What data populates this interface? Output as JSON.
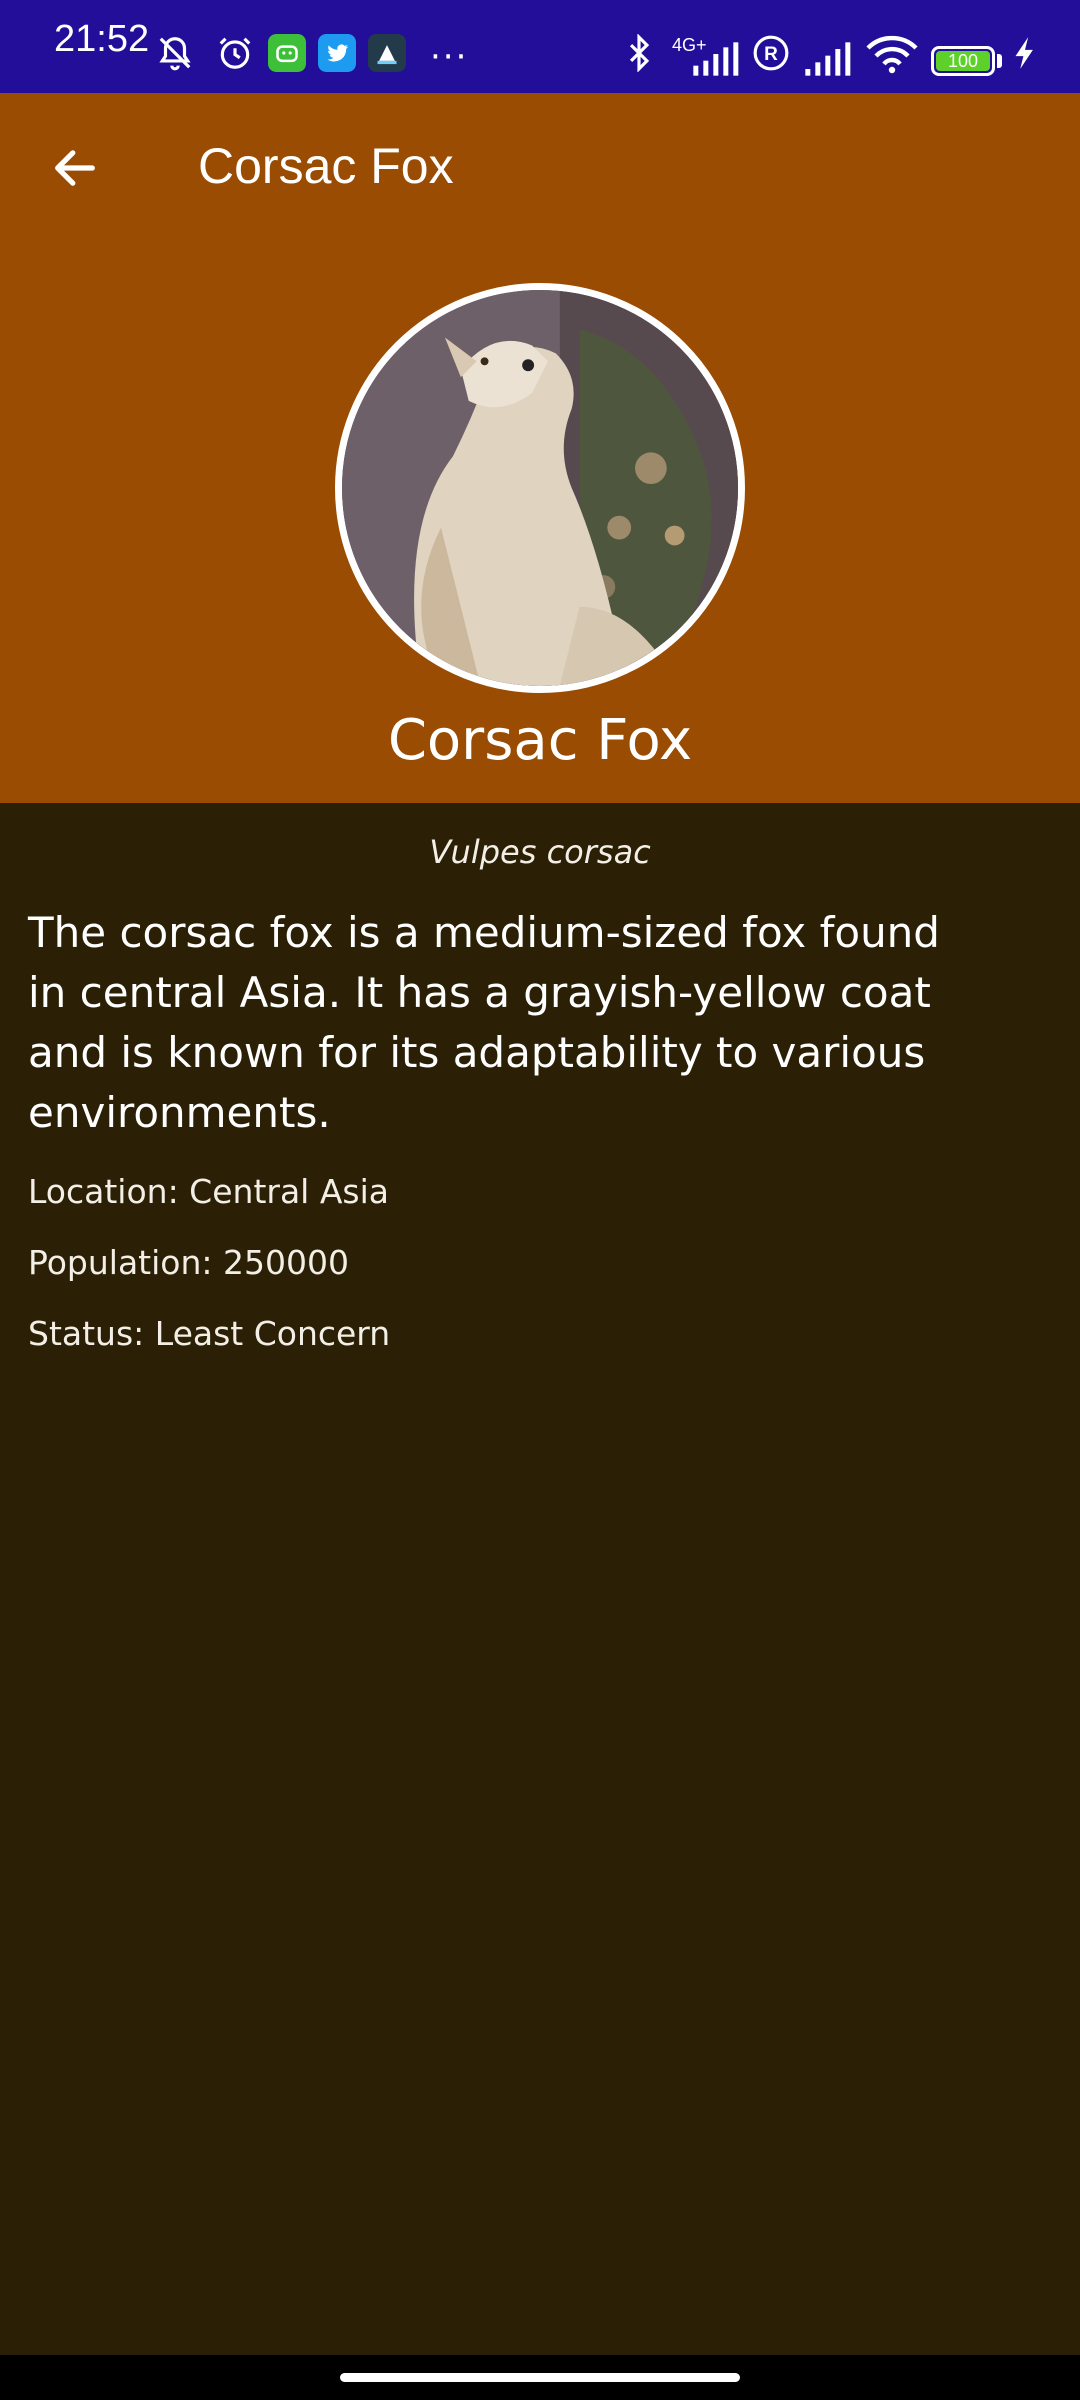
{
  "status_bar": {
    "time": "21:52",
    "network_type": "4G+",
    "battery_level": "100",
    "battery_color": "#5dd12a",
    "background": "#230e99",
    "icons": [
      "muted-bell-icon",
      "alarm-icon",
      "android-app-icon",
      "twitter-icon",
      "app-icon",
      "more-dots-icon",
      "bluetooth-icon",
      "signal-icon",
      "roaming-icon",
      "signal-icon",
      "wifi-icon",
      "battery-icon",
      "charging-icon"
    ]
  },
  "app_bar": {
    "title": "Corsac Fox",
    "back_icon": "arrow-left-icon",
    "background": "#994c02"
  },
  "animal": {
    "name": "Corsac Fox",
    "scientific_name": "Vulpes corsac",
    "description": "The corsac fox is a medium-sized fox found in central Asia. It has a grayish-yellow coat and is known for its adaptability to various environments.",
    "location": "Location: Central Asia",
    "population": "Population: 250000",
    "status": "Status: Least Concern"
  },
  "colors": {
    "page_background": "#2b2005",
    "text": "#ffffff"
  }
}
